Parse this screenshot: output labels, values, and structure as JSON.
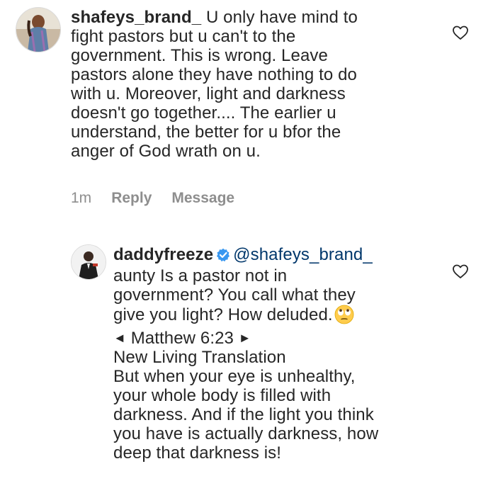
{
  "comment1": {
    "username": "shafeys_brand_",
    "text_lines": [
      "U only have mind to",
      "fight pastors but u can't to the",
      "government. This is wrong. Leave",
      "pastors alone they have nothing to do",
      "with u. Moreover, light and darkness",
      "doesn't go together.... The earlier u",
      "understand, the better for u bfor the",
      "anger of God  wrath on u."
    ],
    "time": "1m",
    "reply_label": "Reply",
    "message_label": "Message",
    "like_icon": "heart-outline-icon"
  },
  "comment2": {
    "username": "daddyfreeze",
    "verified_icon": "verified-badge-icon",
    "mention": "@shafeys_brand_",
    "text_lines": [
      "aunty Is a pastor not in",
      "government? You call what they",
      "give you light? How deluded."
    ],
    "emoji": "face-with-rolling-eyes-emoji",
    "arrow_left": "◄",
    "verse_ref": "Matthew 6:23",
    "arrow_right": "►",
    "translation": "New Living Translation",
    "verse_lines": [
      "But when your eye is unhealthy,",
      "your whole body is filled with",
      "darkness. And if the light you think",
      "you have is actually darkness, how",
      "deep that darkness is!"
    ],
    "like_icon": "heart-outline-icon"
  },
  "colors": {
    "text": "#262626",
    "meta": "#8e8e8e",
    "mention": "#00376b",
    "verified": "#3897f0"
  }
}
